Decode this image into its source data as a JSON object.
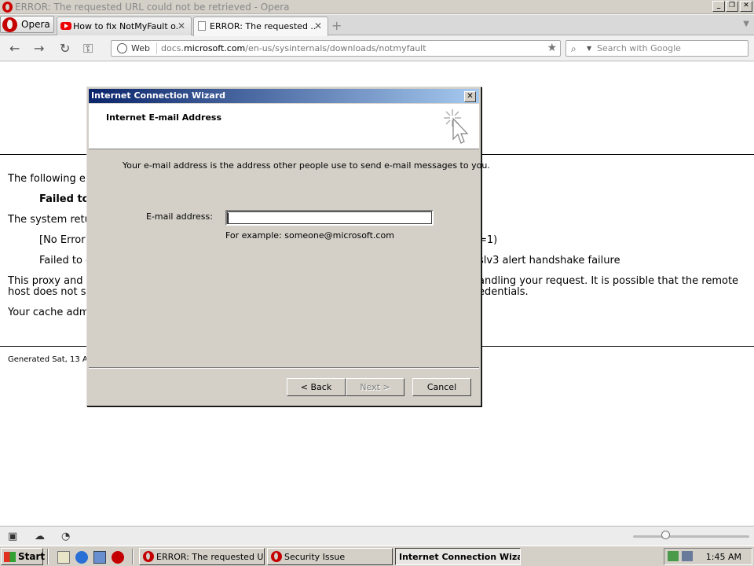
{
  "window": {
    "title": "ERROR: The requested URL could not be retrieved - Opera",
    "minimize": "_",
    "restore": "❐",
    "close": "✕"
  },
  "tabs": {
    "opera_menu": "Opera",
    "items": [
      {
        "label": "How to fix NotMyFault o...",
        "icon": "youtube-icon"
      },
      {
        "label": "ERROR: The requested ...",
        "icon": "page-icon"
      }
    ],
    "close_glyph": "✕",
    "new_tab": "+",
    "tab_menu": "▼"
  },
  "nav": {
    "back": "←",
    "forward": "→",
    "reload": "↻",
    "key": "⚿",
    "web_label": "Web",
    "url_prefix": "docs.",
    "url_domain": "microsoft.com",
    "url_path": "/en-us/sysinternals/downloads/notmyfault",
    "star": "★",
    "search_placeholder": "Search with Google"
  },
  "page": {
    "line1": "The following er",
    "line2": "Failed to",
    "line3": "The system retu",
    "line4a": "[No Error]",
    "line4b": "=1)",
    "line5a": "Failed to c",
    "line5b": "slv3 alert handshake failure",
    "line6a": "This proxy and t",
    "line6b": "andling your request. It is possible that the remote",
    "line7a": "host does not s",
    "line7b": "edentials.",
    "line8": "Your cache adm",
    "footer": "Generated Sat, 13 A"
  },
  "dialog": {
    "title": "Internet Connection Wizard",
    "close": "✕",
    "header_title": "Internet E-mail Address",
    "description": "Your e-mail address is the address other people use to send e-mail messages to you.",
    "email_label": "E-mail address:",
    "email_value": "",
    "example": "For example: someone@microsoft.com",
    "back_button": "< Back",
    "next_button": "Next >",
    "cancel_button": "Cancel"
  },
  "taskbar": {
    "start": "Start",
    "buttons": [
      {
        "label": "ERROR: The requested U..."
      },
      {
        "label": "Security Issue"
      },
      {
        "label": "Internet Connection Wiza..."
      }
    ],
    "clock": "1:45 AM"
  }
}
